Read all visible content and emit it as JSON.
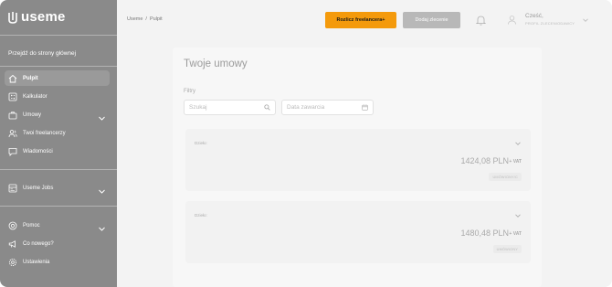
{
  "brand": {
    "name": "useme"
  },
  "sidebar": {
    "back_link": "Przejdź do strony głównej",
    "items": [
      {
        "label": "Pulpit",
        "icon": "home-icon",
        "active": true
      },
      {
        "label": "Kalkulator",
        "icon": "calculator-icon"
      },
      {
        "label": "Umowy",
        "icon": "briefcase-icon",
        "expandable": true
      },
      {
        "label": "Twoi freelancerzy",
        "icon": "users-icon"
      },
      {
        "label": "Wiadomości",
        "icon": "chat-icon"
      },
      {
        "label": "Useme Jobs",
        "icon": "jobs-icon",
        "expandable": true
      },
      {
        "label": "Pomoc",
        "icon": "help-icon",
        "expandable": true
      },
      {
        "label": "Co nowego?",
        "icon": "megaphone-icon"
      },
      {
        "label": "Ustawienia",
        "icon": "gear-icon"
      }
    ]
  },
  "header": {
    "breadcrumb": [
      "Useme",
      "/",
      "Pulpit"
    ],
    "primary_button": "Rozlicz freelancera+",
    "secondary_button": "Dodaj zlecenie",
    "user": {
      "greeting": "Cześć,",
      "profile_type": "PROFIL ZLECENIODAWCY"
    }
  },
  "main": {
    "title": "Twoje umowy",
    "filters": {
      "label": "Filtry",
      "search_placeholder": "Szukaj",
      "date_placeholder": "Data zawarcia"
    },
    "contracts": [
      {
        "label": "Dzieło:",
        "amount": "1424,08 PLN",
        "vat": "+ VAT",
        "status": "UMÓWIONY/C"
      },
      {
        "label": "Dzieło:",
        "amount": "1480,48 PLN",
        "vat": "+ VAT",
        "status": "UMÓWIONY"
      }
    ]
  },
  "colors": {
    "sidebar_bg": "#8a8a8a",
    "primary_accent": "#f49a0c",
    "secondary_button": "#b8b8b8"
  }
}
